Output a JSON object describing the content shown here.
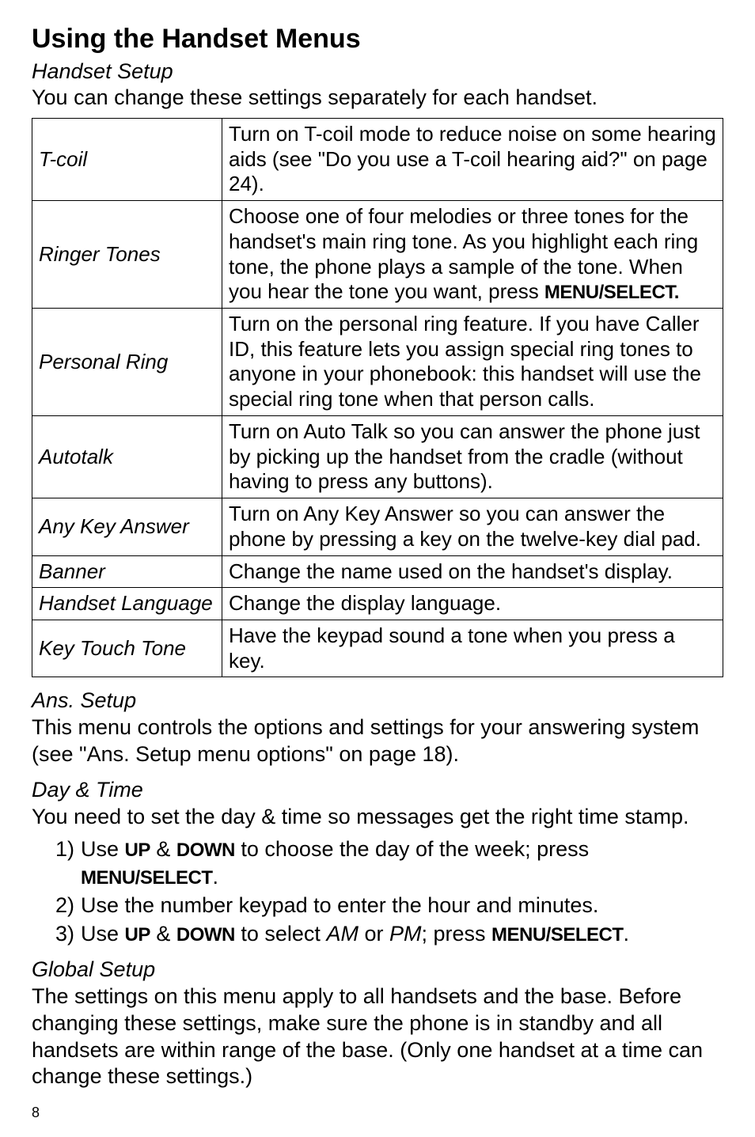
{
  "page_title": "Using the Handset Menus",
  "handset_setup": {
    "heading": "Handset Setup",
    "intro": "You can change these settings separately for each handset.",
    "rows": [
      {
        "label": "T-coil",
        "description": "Turn on T-coil mode to reduce noise on some hearing aids (see \"Do you use a T-coil hearing aid?\" on page 24).",
        "trailing_keycap": ""
      },
      {
        "label": "Ringer Tones",
        "description": "Choose one of four melodies or three tones for the handset's main ring tone. As you highlight each ring tone, the phone plays a sample of the tone. When you hear the tone you want, press ",
        "trailing_keycap": "MENU/SELECT."
      },
      {
        "label": "Personal Ring",
        "description": "Turn on the personal ring feature. If you have Caller ID, this feature lets you assign special ring tones to anyone in your phonebook: this handset will use the special ring tone when that person calls.",
        "trailing_keycap": ""
      },
      {
        "label": "Autotalk",
        "description": "Turn on Auto Talk so you can answer the phone just by picking up the handset from the cradle (without having to press any buttons).",
        "trailing_keycap": ""
      },
      {
        "label": "Any Key Answer",
        "description": "Turn on Any Key Answer so you can answer the phone by pressing a key on the twelve-key dial pad.",
        "trailing_keycap": ""
      },
      {
        "label": "Banner",
        "description": "Change the name used on the handset's display.",
        "trailing_keycap": ""
      },
      {
        "label": "Handset Language",
        "description": "Change the display language.",
        "trailing_keycap": ""
      },
      {
        "label": "Key Touch Tone",
        "description": "Have the keypad sound a tone when you press a key.",
        "trailing_keycap": ""
      }
    ]
  },
  "ans_setup": {
    "heading": "Ans. Setup",
    "body": "This menu controls the options and settings for your answering system (see \"Ans. Setup menu options\" on page 18)."
  },
  "day_time": {
    "heading": "Day & Time",
    "intro": "You need to set the day & time so messages get the right time stamp.",
    "steps": {
      "s1_pre": "Use ",
      "s1_k1": "UP",
      "s1_mid": " & ",
      "s1_k2": "DOWN",
      "s1_post": " to choose the day of the week; press ",
      "s1_k3": "MENU/SELECT",
      "s1_end": ".",
      "s2": "Use the number keypad to enter the hour and minutes.",
      "s3_pre": "Use ",
      "s3_k1": "UP",
      "s3_mid": " & ",
      "s3_k2": "DOWN",
      "s3_post": " to select ",
      "s3_i1": "AM",
      "s3_or": " or ",
      "s3_i2": "PM",
      "s3_semi": "; press ",
      "s3_k3": "MENU/SELECT",
      "s3_end": "."
    }
  },
  "global_setup": {
    "heading": "Global Setup",
    "body": "The settings on this menu apply to all handsets and the base. Before changing these settings, make sure the phone is in standby and all handsets are within range of the base. (Only one handset at a  time can change these settings.)"
  },
  "page_number": "8"
}
